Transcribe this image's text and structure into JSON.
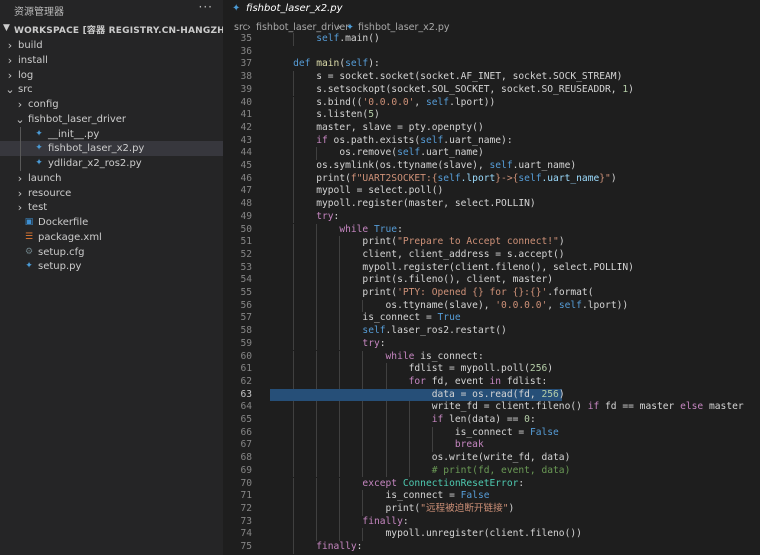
{
  "sidebar": {
    "title": "资源管理器",
    "more": "···",
    "workspace": "WORKSPACE [容器 REGISTRY.CN-HANGZHOU.ALIYUNCS...",
    "items": [
      {
        "label": "build",
        "type": "folder",
        "depth": 0,
        "expanded": false
      },
      {
        "label": "install",
        "type": "folder",
        "depth": 0,
        "expanded": false
      },
      {
        "label": "log",
        "type": "folder",
        "depth": 0,
        "expanded": false
      },
      {
        "label": "src",
        "type": "folder",
        "depth": 0,
        "expanded": true
      },
      {
        "label": "config",
        "type": "folder",
        "depth": 1,
        "expanded": false
      },
      {
        "label": "fishbot_laser_driver",
        "type": "folder",
        "depth": 1,
        "expanded": true
      },
      {
        "label": "__init__.py",
        "type": "python",
        "depth": 2
      },
      {
        "label": "fishbot_laser_x2.py",
        "type": "python",
        "depth": 2,
        "selected": true
      },
      {
        "label": "ydlidar_x2_ros2.py",
        "type": "python",
        "depth": 2
      },
      {
        "label": "launch",
        "type": "folder",
        "depth": 1,
        "expanded": false
      },
      {
        "label": "resource",
        "type": "folder",
        "depth": 1,
        "expanded": false
      },
      {
        "label": "test",
        "type": "folder",
        "depth": 1,
        "expanded": false
      },
      {
        "label": "Dockerfile",
        "type": "docker",
        "depth": 1
      },
      {
        "label": "package.xml",
        "type": "xml",
        "depth": 1
      },
      {
        "label": "setup.cfg",
        "type": "config",
        "depth": 1
      },
      {
        "label": "setup.py",
        "type": "python",
        "depth": 1
      }
    ]
  },
  "editor": {
    "tab_label": "fishbot_laser_x2.py",
    "breadcrumb": [
      "src",
      "fishbot_laser_driver",
      "fishbot_laser_x2.py"
    ],
    "current_line": 63,
    "selected_line": 63,
    "lines": [
      {
        "no": "35",
        "indent": 2,
        "tokens": [
          [
            "self",
            "k"
          ],
          [
            ".main()",
            ""
          ]
        ]
      },
      {
        "no": "36",
        "indent": 0,
        "tokens": []
      },
      {
        "no": "37",
        "indent": 1,
        "tokens": [
          [
            "def ",
            "k"
          ],
          [
            "main",
            "f"
          ],
          [
            "(",
            ""
          ],
          [
            "self",
            "k"
          ],
          [
            "):",
            ""
          ]
        ]
      },
      {
        "no": "38",
        "indent": 2,
        "tokens": [
          [
            "s = socket.socket(socket.AF_INET, socket.SOCK_STREAM)",
            ""
          ]
        ]
      },
      {
        "no": "39",
        "indent": 2,
        "tokens": [
          [
            "s.setsockopt(socket.SOL_SOCKET, socket.SO_REUSEADDR, ",
            ""
          ],
          [
            "1",
            "n"
          ],
          [
            ")",
            ""
          ]
        ]
      },
      {
        "no": "40",
        "indent": 2,
        "tokens": [
          [
            "s.bind((",
            ""
          ],
          [
            "'0.0.0.0'",
            "s"
          ],
          [
            ", ",
            ""
          ],
          [
            "self",
            "k"
          ],
          [
            ".lport))",
            ""
          ]
        ]
      },
      {
        "no": "41",
        "indent": 2,
        "tokens": [
          [
            "s.listen(",
            ""
          ],
          [
            "5",
            "n"
          ],
          [
            ")",
            ""
          ]
        ]
      },
      {
        "no": "42",
        "indent": 2,
        "tokens": [
          [
            "master, slave = pty.openpty()",
            ""
          ]
        ]
      },
      {
        "no": "43",
        "indent": 2,
        "tokens": [
          [
            "if ",
            "c"
          ],
          [
            "os.path.exists(",
            ""
          ],
          [
            "self",
            "k"
          ],
          [
            ".uart_name):",
            ""
          ]
        ]
      },
      {
        "no": "44",
        "indent": 3,
        "tokens": [
          [
            "os.remove(",
            ""
          ],
          [
            "self",
            "k"
          ],
          [
            ".uart_name)",
            ""
          ]
        ]
      },
      {
        "no": "45",
        "indent": 2,
        "tokens": [
          [
            "os.symlink(os.ttyname(slave), ",
            ""
          ],
          [
            "self",
            "k"
          ],
          [
            ".uart_name)",
            ""
          ]
        ]
      },
      {
        "no": "46",
        "indent": 2,
        "tokens": [
          [
            "print(",
            ""
          ],
          [
            "f\"UART2SOCKET:{",
            "s"
          ],
          [
            "self",
            "k"
          ],
          [
            ".lport",
            "v"
          ],
          [
            "}->{",
            "s"
          ],
          [
            "self",
            "k"
          ],
          [
            ".uart_name",
            "v"
          ],
          [
            "}\"",
            "s"
          ],
          [
            ")",
            ""
          ]
        ]
      },
      {
        "no": "47",
        "indent": 2,
        "tokens": [
          [
            "mypoll = select.poll()",
            ""
          ]
        ]
      },
      {
        "no": "48",
        "indent": 2,
        "tokens": [
          [
            "mypoll.register(master, select.POLLIN)",
            ""
          ]
        ]
      },
      {
        "no": "49",
        "indent": 2,
        "tokens": [
          [
            "try",
            "c"
          ],
          [
            ":",
            ""
          ]
        ]
      },
      {
        "no": "50",
        "indent": 3,
        "tokens": [
          [
            "while ",
            "c"
          ],
          [
            "True",
            "k"
          ],
          [
            ":",
            ""
          ]
        ]
      },
      {
        "no": "51",
        "indent": 4,
        "tokens": [
          [
            "print(",
            ""
          ],
          [
            "\"Prepare to Accept connect!\"",
            "s"
          ],
          [
            ")",
            ""
          ]
        ]
      },
      {
        "no": "52",
        "indent": 4,
        "tokens": [
          [
            "client, client_address = s.accept()",
            ""
          ]
        ]
      },
      {
        "no": "53",
        "indent": 4,
        "tokens": [
          [
            "mypoll.register(client.fileno(), select.POLLIN)",
            ""
          ]
        ]
      },
      {
        "no": "54",
        "indent": 4,
        "tokens": [
          [
            "print(s.fileno(), client, master)",
            ""
          ]
        ]
      },
      {
        "no": "55",
        "indent": 4,
        "tokens": [
          [
            "print(",
            ""
          ],
          [
            "'PTY: Opened {} for {}:{}'",
            "s"
          ],
          [
            ".format(",
            ""
          ]
        ]
      },
      {
        "no": "56",
        "indent": 5,
        "tokens": [
          [
            "os.ttyname(slave), ",
            ""
          ],
          [
            "'0.0.0.0'",
            "s"
          ],
          [
            ", ",
            ""
          ],
          [
            "self",
            "k"
          ],
          [
            ".lport))",
            ""
          ]
        ]
      },
      {
        "no": "57",
        "indent": 4,
        "tokens": [
          [
            "is_connect = ",
            ""
          ],
          [
            "True",
            "k"
          ]
        ]
      },
      {
        "no": "58",
        "indent": 4,
        "tokens": [
          [
            "self",
            "k"
          ],
          [
            ".laser_ros2.restart()",
            ""
          ]
        ]
      },
      {
        "no": "59",
        "indent": 4,
        "tokens": [
          [
            "try",
            "c"
          ],
          [
            ":",
            ""
          ]
        ]
      },
      {
        "no": "60",
        "indent": 5,
        "tokens": [
          [
            "while ",
            "c"
          ],
          [
            "is_connect:",
            ""
          ]
        ]
      },
      {
        "no": "61",
        "indent": 6,
        "tokens": [
          [
            "fdlist = mypoll.poll(",
            ""
          ],
          [
            "256",
            "n"
          ],
          [
            ")",
            ""
          ]
        ]
      },
      {
        "no": "62",
        "indent": 6,
        "tokens": [
          [
            "for ",
            "c"
          ],
          [
            "fd, event ",
            ""
          ],
          [
            "in ",
            "c"
          ],
          [
            "fdlist:",
            ""
          ]
        ]
      },
      {
        "no": "63",
        "indent": 7,
        "tokens": [
          [
            "data = os.read(fd, ",
            ""
          ],
          [
            "256",
            "n"
          ],
          [
            ")",
            ""
          ]
        ]
      },
      {
        "no": "64",
        "indent": 7,
        "tokens": [
          [
            "write_fd = client.fileno() ",
            ""
          ],
          [
            "if ",
            "c"
          ],
          [
            "fd == master ",
            ""
          ],
          [
            "else ",
            "c"
          ],
          [
            "master",
            ""
          ]
        ]
      },
      {
        "no": "65",
        "indent": 7,
        "tokens": [
          [
            "if ",
            "c"
          ],
          [
            "len(data) == ",
            ""
          ],
          [
            "0",
            "n"
          ],
          [
            ":",
            ""
          ]
        ]
      },
      {
        "no": "66",
        "indent": 8,
        "tokens": [
          [
            "is_connect = ",
            ""
          ],
          [
            "False",
            "k"
          ]
        ]
      },
      {
        "no": "67",
        "indent": 8,
        "tokens": [
          [
            "break",
            "c"
          ]
        ]
      },
      {
        "no": "68",
        "indent": 7,
        "tokens": [
          [
            "os.write(write_fd, data)",
            ""
          ]
        ]
      },
      {
        "no": "69",
        "indent": 7,
        "tokens": [
          [
            "# print(fd, event, data)",
            "m"
          ]
        ]
      },
      {
        "no": "70",
        "indent": 4,
        "tokens": [
          [
            "except ",
            "c"
          ],
          [
            "ConnectionResetError",
            "t"
          ],
          [
            ":",
            ""
          ]
        ]
      },
      {
        "no": "71",
        "indent": 5,
        "tokens": [
          [
            "is_connect = ",
            ""
          ],
          [
            "False",
            "k"
          ]
        ]
      },
      {
        "no": "72",
        "indent": 5,
        "tokens": [
          [
            "print(",
            ""
          ],
          [
            "\"远程被迫断开链接\"",
            "s"
          ],
          [
            ")",
            ""
          ]
        ]
      },
      {
        "no": "73",
        "indent": 4,
        "tokens": [
          [
            "finally",
            "c"
          ],
          [
            ":",
            ""
          ]
        ]
      },
      {
        "no": "74",
        "indent": 5,
        "tokens": [
          [
            "mypoll.unregister(client.fileno())",
            ""
          ]
        ]
      },
      {
        "no": "75",
        "indent": 2,
        "tokens": [
          [
            "finally",
            "c"
          ],
          [
            ":",
            ""
          ]
        ]
      }
    ]
  }
}
